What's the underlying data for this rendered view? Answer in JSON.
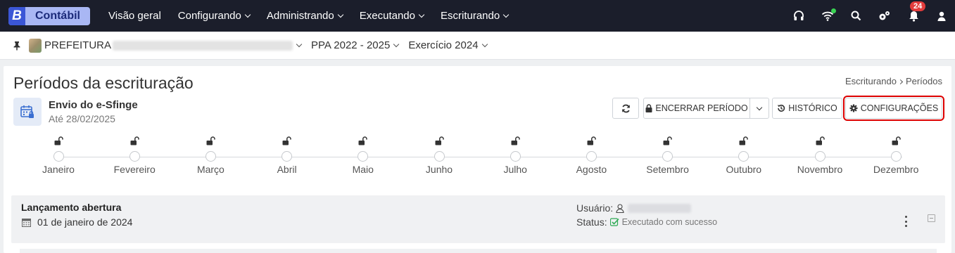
{
  "brand": {
    "letter": "B",
    "name": "Contábil"
  },
  "nav": [
    {
      "label": "Visão geral",
      "dropdown": false
    },
    {
      "label": "Configurando",
      "dropdown": true
    },
    {
      "label": "Administrando",
      "dropdown": true
    },
    {
      "label": "Executando",
      "dropdown": true
    },
    {
      "label": "Escriturando",
      "dropdown": true
    }
  ],
  "top_icons": {
    "headset": "headset-icon",
    "wifi": "wifi-icon",
    "search": "search-icon",
    "settings": "gears-icon",
    "notifications": "bell-icon",
    "notification_count": "24",
    "user": "user-icon"
  },
  "context": {
    "entity": "PREFEITURA",
    "ppa": "PPA 2022 - 2025",
    "exercicio": "Exercício 2024"
  },
  "page": {
    "title": "Períodos da escrituração",
    "breadcrumb": [
      "Escriturando",
      "Períodos"
    ]
  },
  "envio": {
    "title": "Envio do e-Sfinge",
    "date": "Até 28/02/2025"
  },
  "actions": {
    "encerrar": "ENCERRAR PERÍODO",
    "historico": "HISTÓRICO",
    "configuracoes": "CONFIGURAÇÕES"
  },
  "months": [
    "Janeiro",
    "Fevereiro",
    "Março",
    "Abril",
    "Maio",
    "Junho",
    "Julho",
    "Agosto",
    "Setembro",
    "Outubro",
    "Novembro",
    "Dezembro"
  ],
  "section": {
    "title": "Lançamento abertura",
    "date": "01 de janeiro de 2024",
    "user_label": "Usuário:",
    "status_label": "Status:",
    "status_text": "Executado com sucesso"
  },
  "colors": {
    "topbar": "#1b1e2b",
    "brand_bg": "#a9b7f4",
    "brand_letter": "#3b56d6",
    "badge": "#e23c3c",
    "success": "#2eaa55",
    "highlight": "#dd0000"
  }
}
